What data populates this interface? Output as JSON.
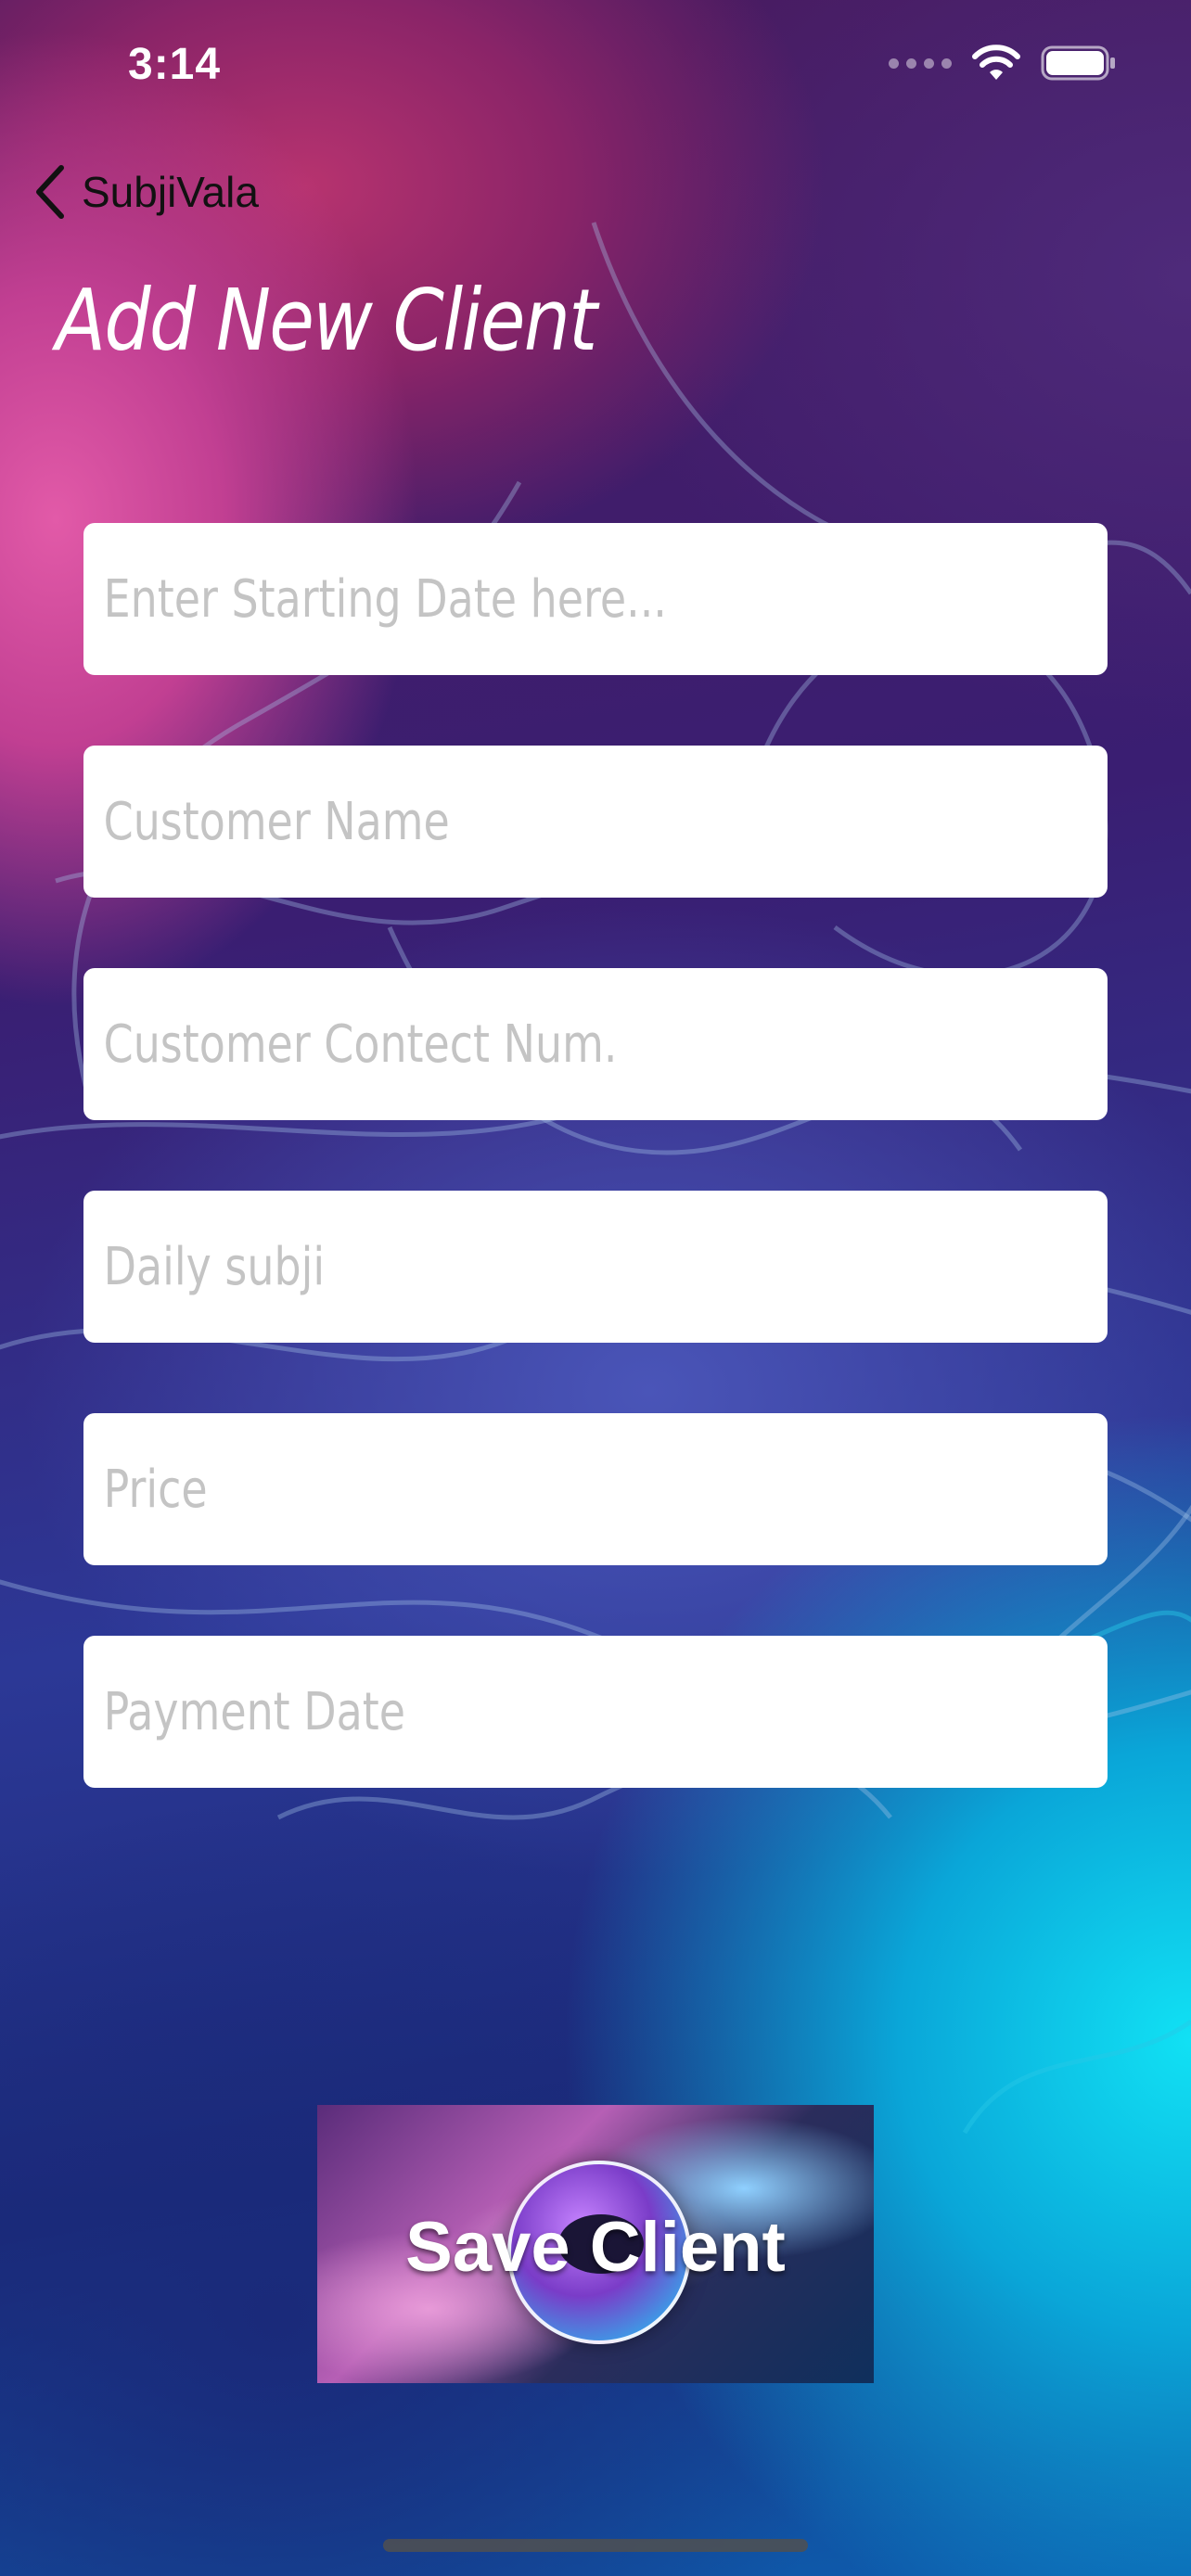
{
  "status_bar": {
    "time": "3:14"
  },
  "nav": {
    "back_label": "SubjiVala"
  },
  "page": {
    "title": "Add New Client"
  },
  "form": {
    "fields": [
      {
        "name": "starting-date",
        "value": "",
        "placeholder": "Enter Starting Date here..."
      },
      {
        "name": "customer-name",
        "value": "",
        "placeholder": "Customer Name"
      },
      {
        "name": "customer-contact",
        "value": "",
        "placeholder": "Customer Contect Num."
      },
      {
        "name": "daily-subji",
        "value": "",
        "placeholder": "Daily subji"
      },
      {
        "name": "price",
        "value": "",
        "placeholder": "Price"
      },
      {
        "name": "payment-date",
        "value": "",
        "placeholder": "Payment Date"
      }
    ]
  },
  "save_button": {
    "label": "Save Client"
  },
  "icons": {
    "back": "chevron-left-icon",
    "wifi": "wifi-icon",
    "battery": "battery-icon",
    "signal": "cellular-signal-icon"
  },
  "colors": {
    "title_text": "#ffffff",
    "back_text": "#111111",
    "placeholder": "#c4c4c4",
    "field_background": "#ffffff"
  }
}
